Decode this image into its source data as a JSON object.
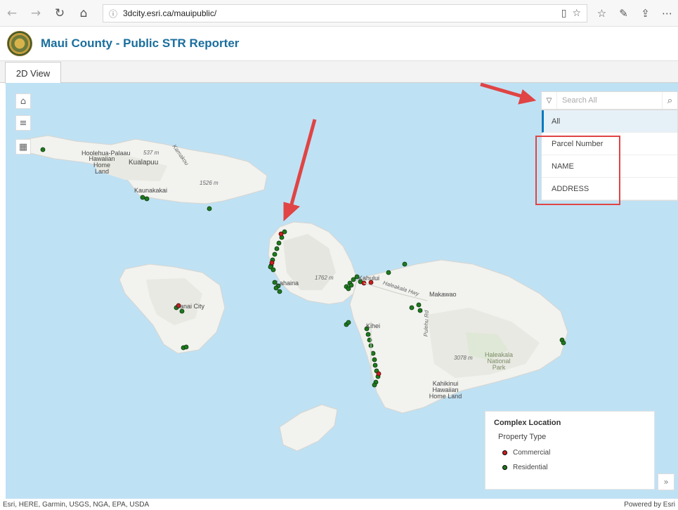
{
  "browser": {
    "url": "3dcity.esri.ca/mauipublic/"
  },
  "app": {
    "title": "Maui County - Public STR Reporter"
  },
  "tabs": [
    {
      "label": "2D View"
    }
  ],
  "search": {
    "placeholder": "Search All",
    "menu": [
      "All",
      "Parcel Number",
      "NAME",
      "ADDRESS"
    ]
  },
  "map": {
    "labels": {
      "hoolehua": "Hoolehua-Palaau",
      "hawaiian_home": "Hawaiian Home Land",
      "kualapuu": "Kualapuu",
      "kaunakakai": "Kaunakakai",
      "elev_537": "537 m",
      "elev_1526": "1526 m",
      "kamakou": "Kamakou",
      "lahaina": "Lahaina",
      "elev_1762": "1762 m",
      "kahului": "Kahului",
      "haleakala_hwy": "Haleakala Hwy",
      "makawao": "Makawao",
      "lanai_city": "Lanai City",
      "kihei": "Kihei",
      "pulehu_rd": "Pulehu Rd",
      "elev_3078": "3078 m",
      "haleakala_park": "Haleakala National Park",
      "kahikinui": "Kahikinui Hawaiian Home Land"
    },
    "colors": {
      "water": "#bfe1f4",
      "land": "#f2f2ef",
      "commercial": "#cc1f1f",
      "residential": "#1e7a1e"
    }
  },
  "legend": {
    "title": "Complex Location",
    "subtitle": "Property Type",
    "items": [
      {
        "label": "Commercial",
        "color": "#cc1f1f"
      },
      {
        "label": "Residential",
        "color": "#1e7a1e"
      }
    ]
  },
  "attribution": {
    "left": "Esri, HERE, Garmin, USGS, NGA, EPA, USDA",
    "right": "Powered by Esri"
  }
}
